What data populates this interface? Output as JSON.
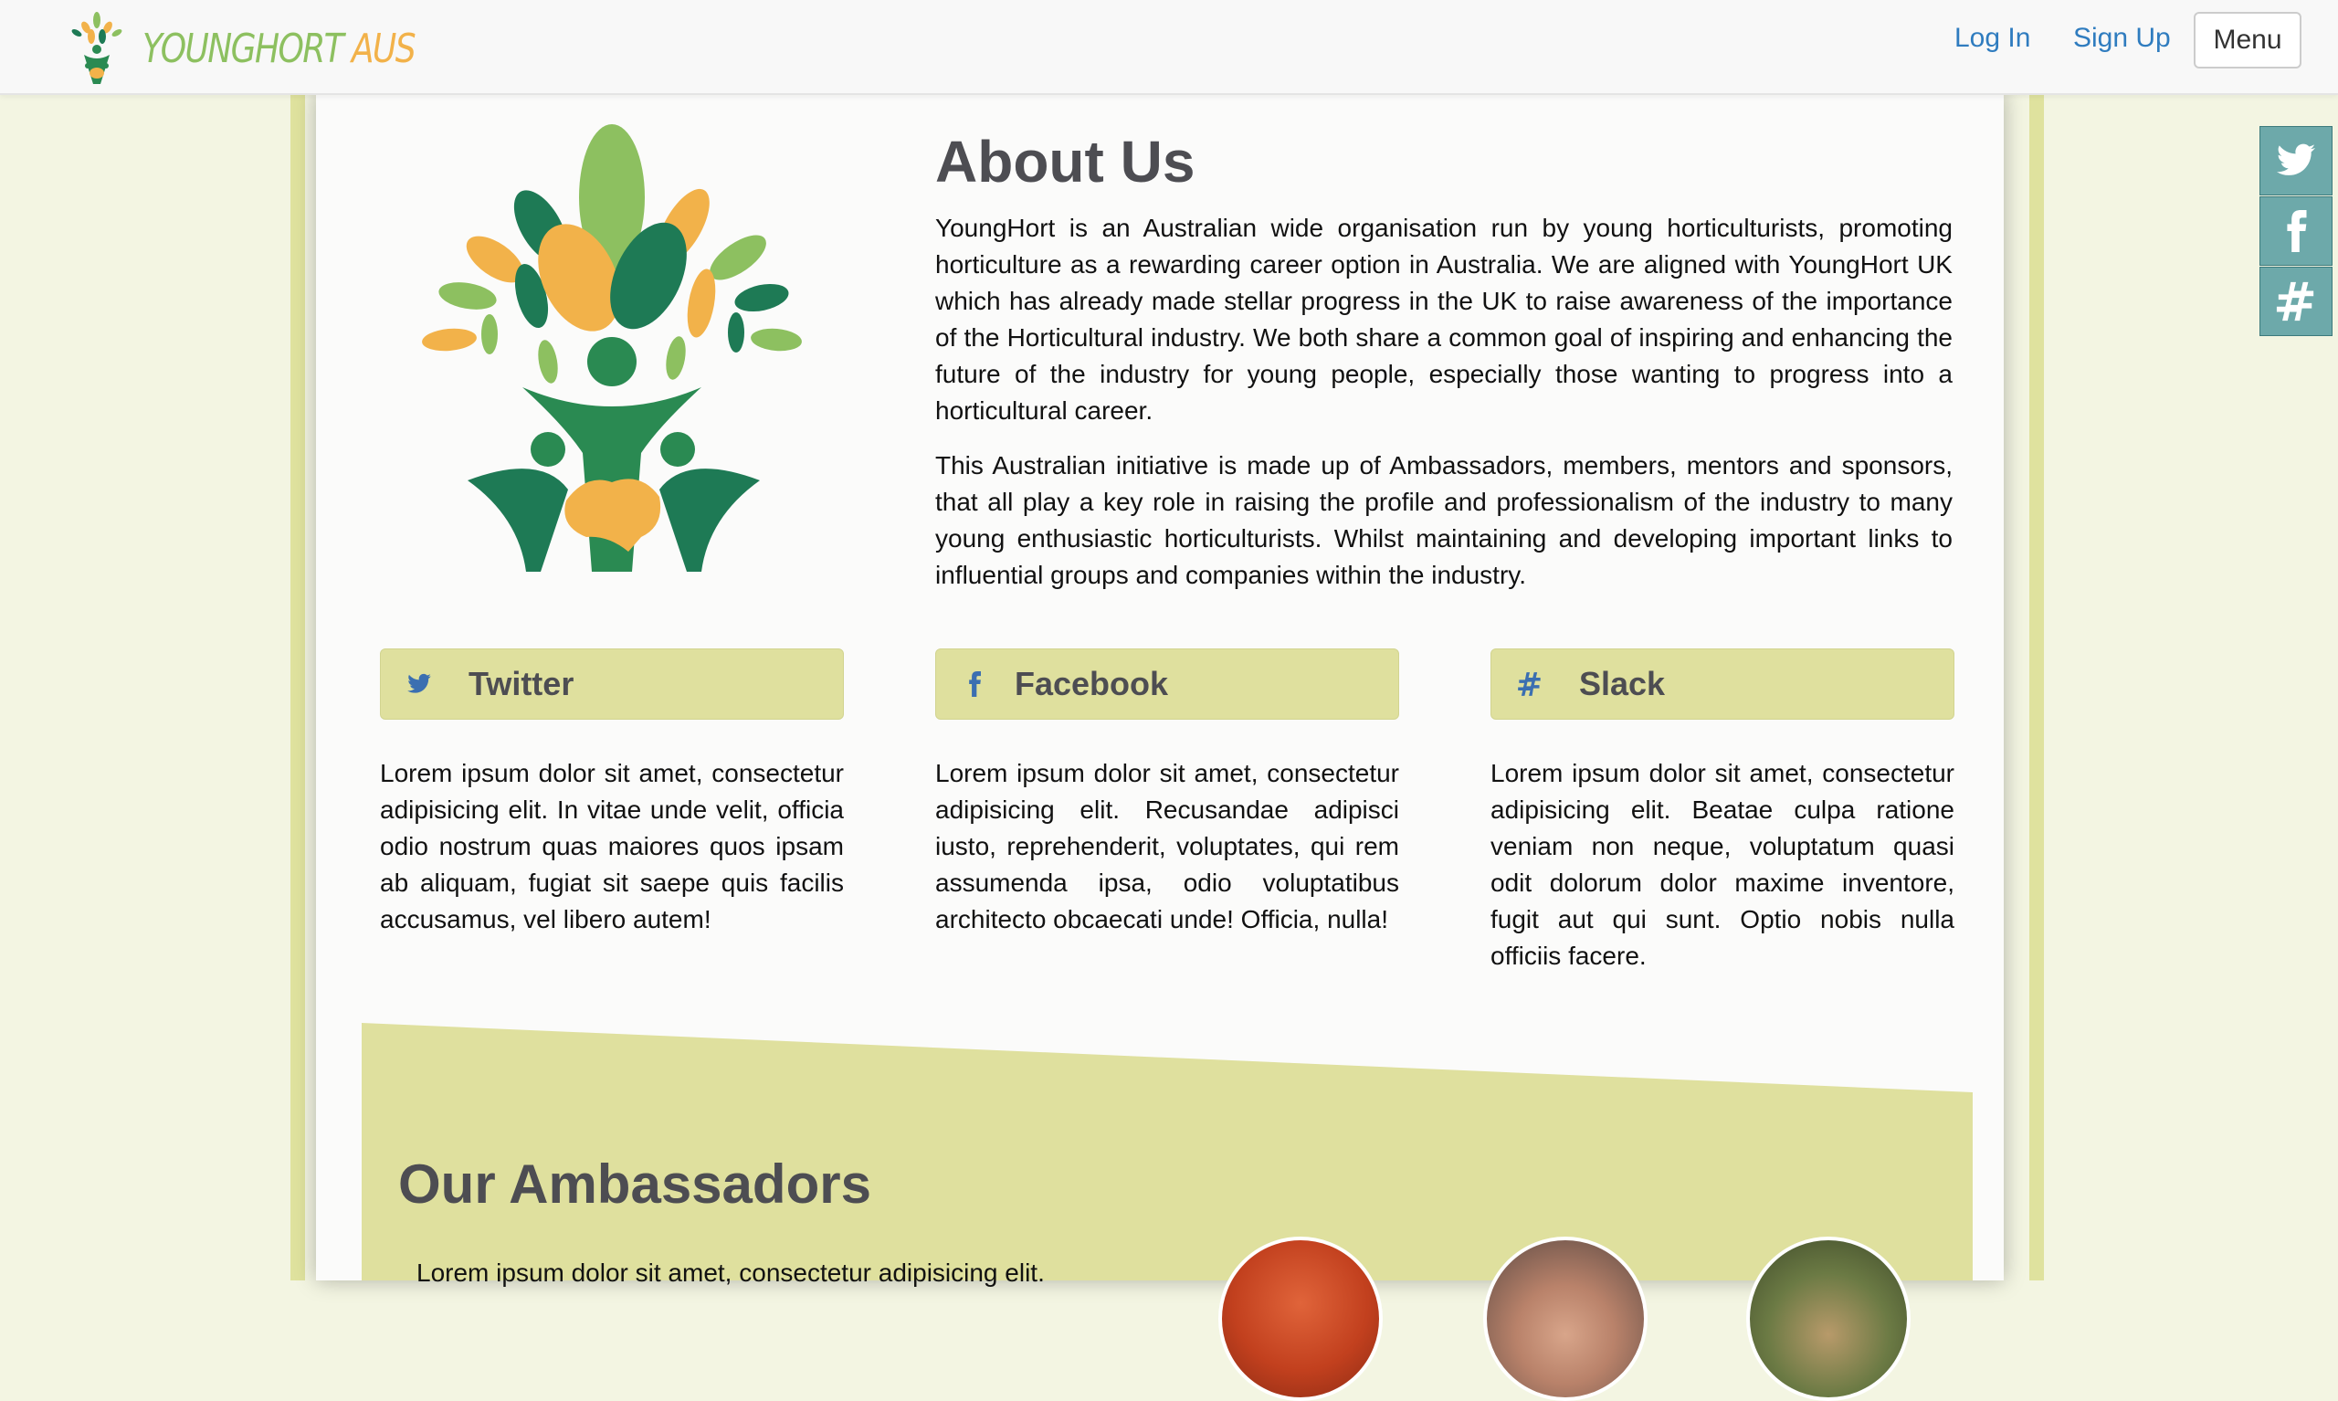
{
  "nav": {
    "brand_word1": "YOUNGHORT",
    "brand_word2": "AUS",
    "login": "Log In",
    "signup": "Sign Up",
    "menu": "Menu"
  },
  "social_sidebar": {
    "items": [
      {
        "icon": "twitter-icon"
      },
      {
        "icon": "facebook-icon"
      },
      {
        "icon": "slack-icon"
      }
    ],
    "color": "#6da9aa"
  },
  "about": {
    "title": "About Us",
    "paragraph1": "YoungHort is an Australian wide organisation run by young horticulturists, promoting horticulture as a rewarding career option in Australia. We are aligned with YoungHort UK which has already made stellar progress in the UK to raise awareness of the importance of the Horticultural industry. We both share a common goal of inspiring and enhancing the future of the industry for young people, especially those wanting to progress into a horticultural career.",
    "paragraph2": "This Australian initiative is made up of Ambassadors, members, mentors and sponsors, that all play a key role in raising the profile and professionalism of the industry to many young enthusiastic horticulturists. Whilst maintaining and developing important links to influential groups and companies within the industry."
  },
  "features": [
    {
      "label": "Twitter",
      "icon": "twitter-icon",
      "text": "Lorem ipsum dolor sit amet, consectetur adipisicing elit. In vitae unde velit, officia odio nostrum quas maiores quos ipsam ab aliquam, fugiat sit saepe quis facilis accusamus, vel libero autem!"
    },
    {
      "label": "Facebook",
      "icon": "facebook-icon",
      "text": "Lorem ipsum dolor sit amet, consectetur adipisicing elit. Recusandae adipisci iusto, reprehenderit, voluptates, qui rem assumenda ipsa, odio voluptatibus architecto obcaecati unde! Officia, nulla!"
    },
    {
      "label": "Slack",
      "icon": "slack-icon",
      "text": "Lorem ipsum dolor sit amet, consectetur adipisicing elit. Beatae culpa ratione veniam non neque, voluptatum quasi odit dolorum dolor maxime inventore, fugit aut qui sunt. Optio nobis nulla officiis facere."
    }
  ],
  "ambassadors": {
    "title": "Our Ambassadors",
    "text": "Lorem ipsum dolor sit amet, consectetur adipisicing elit."
  },
  "colors": {
    "accent": "#dfe09e",
    "link": "#2f7cbf",
    "heading": "#4d4d52",
    "logo_green": "#8dc060",
    "logo_orange": "#f2b24a"
  }
}
